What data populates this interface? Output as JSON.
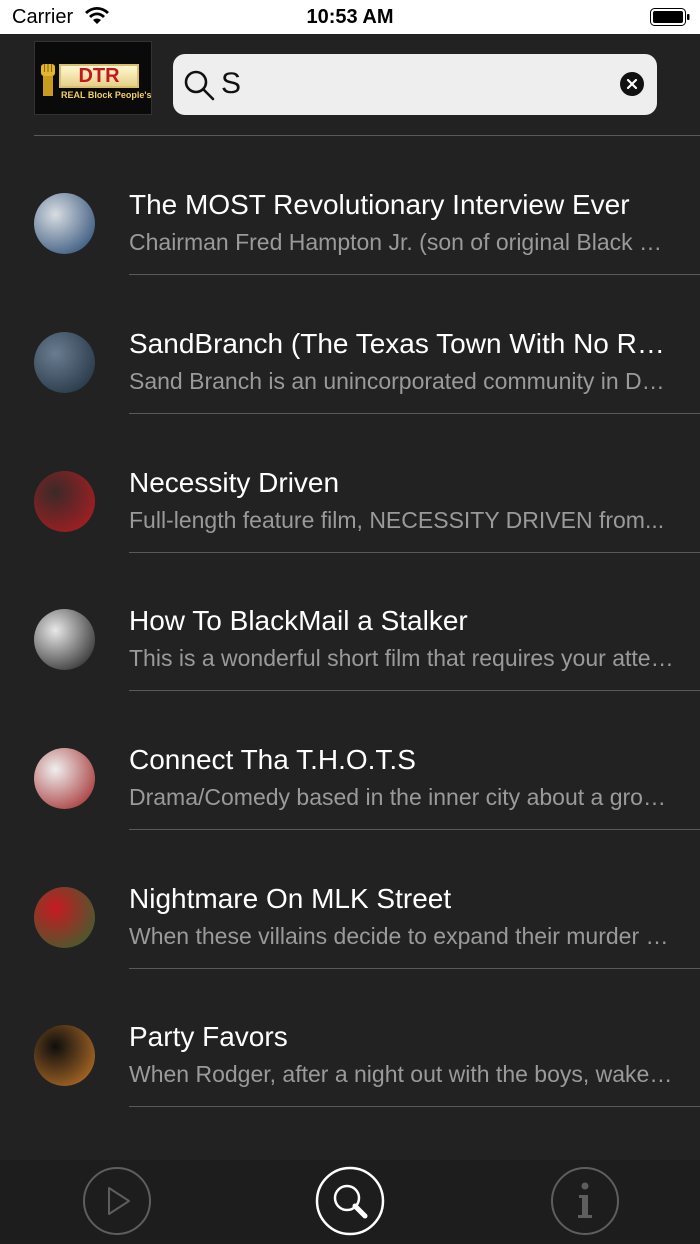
{
  "status_bar": {
    "carrier": "Carrier",
    "time": "10:53 AM"
  },
  "header": {
    "logo_text": "DTR",
    "logo_subtext": "REAL Block People's",
    "search": {
      "value": "S",
      "placeholder": ""
    }
  },
  "results": [
    {
      "title": "The MOST Revolutionary Interview Ever",
      "subtitle": "Chairman Fred Hampton Jr. (son of original Black Panther...",
      "thumb_colors": [
        "#d8dde2",
        "#1b3f6b"
      ]
    },
    {
      "title": "SandBranch (The Texas Town With No Running Water)",
      "subtitle": "Sand Branch is an unincorporated community in Dallas...",
      "thumb_colors": [
        "#6a7d90",
        "#1a2a3a"
      ]
    },
    {
      "title": "Necessity Driven",
      "subtitle": "Full-length feature film, NECESSITY DRIVEN from...",
      "thumb_colors": [
        "#3a2a28",
        "#b81c22"
      ]
    },
    {
      "title": "How To BlackMail a Stalker",
      "subtitle": "This is a wonderful short film that requires your attention...",
      "thumb_colors": [
        "#e8e8e8",
        "#111111"
      ]
    },
    {
      "title": "Connect Tha T.H.O.T.S",
      "subtitle": "Drama/Comedy based in the inner city about a group...",
      "thumb_colors": [
        "#efefef",
        "#9a1a1a"
      ]
    },
    {
      "title": "Nightmare On MLK Street",
      "subtitle": "When these villains decide to expand their murder spree...",
      "thumb_colors": [
        "#c81a22",
        "#2a6a30"
      ]
    },
    {
      "title": "Party Favors",
      "subtitle": "When Rodger, after a night out with the boys, wakes up...",
      "thumb_colors": [
        "#0e0e0e",
        "#c87a2a"
      ]
    }
  ],
  "tabs": [
    {
      "icon": "play-icon",
      "active": false
    },
    {
      "icon": "search-icon",
      "active": true
    },
    {
      "icon": "info-icon",
      "active": false
    }
  ],
  "colors": {
    "background": "#222222",
    "divider": "#5a5a5a",
    "title_text": "#ffffff",
    "subtitle_text": "#9a9a9a",
    "tab_active": "#ffffff",
    "tab_inactive": "#5e5e5e"
  }
}
